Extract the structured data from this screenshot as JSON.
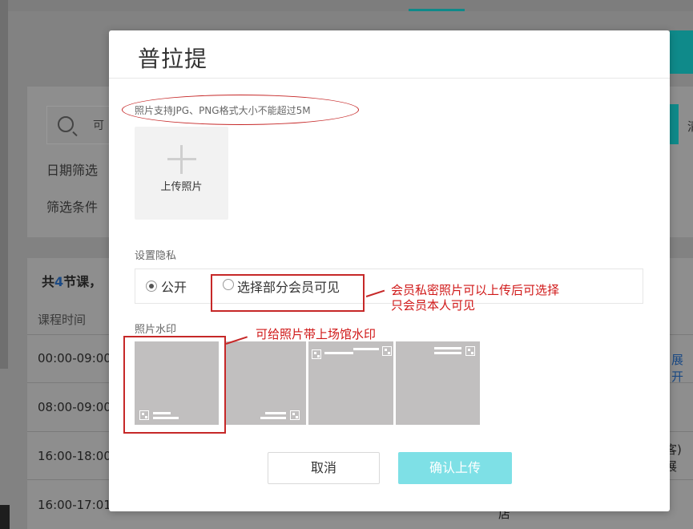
{
  "background": {
    "search_placeholder": "可",
    "date_filter_label": "日期筛选",
    "filter_condition_label": "筛选条件",
    "count_prefix": "共",
    "count_number": "4",
    "count_suffix": "节课，",
    "column_time": "课程时间",
    "rows": [
      {
        "time": "00:00-09:00",
        "action": "展开"
      },
      {
        "time": "08:00-09:00",
        "action": ""
      },
      {
        "time": "16:00-18:00",
        "action": "客) 展"
      },
      {
        "time": "16:00-17:01",
        "action": "店"
      }
    ],
    "right_cut_text": "清"
  },
  "modal": {
    "title": "普拉提",
    "upload_hint": "照片支持JPG、PNG格式大小不能超过5M",
    "upload_button_label": "上传照片",
    "privacy_section_title": "设置隐私",
    "privacy_options": [
      {
        "label": "公开",
        "checked": true
      },
      {
        "label": "选择部分会员可见",
        "checked": false
      }
    ],
    "watermark_section_title": "照片水印",
    "watermark_options": [
      "bottom-left",
      "bottom-right",
      "top-right",
      "top-right-small"
    ],
    "cancel_label": "取消",
    "confirm_label": "确认上传"
  },
  "annotations": {
    "privacy_note_line1": "会员私密照片可以上传后可选择",
    "privacy_note_line2": "只会员本人可见",
    "watermark_note": "可给照片带上场馆水印"
  },
  "colors": {
    "accent_teal": "#0f8a8a",
    "confirm_button": "#7ee0e6",
    "annotation_red": "#c62828",
    "count_blue": "#1b4a85"
  }
}
